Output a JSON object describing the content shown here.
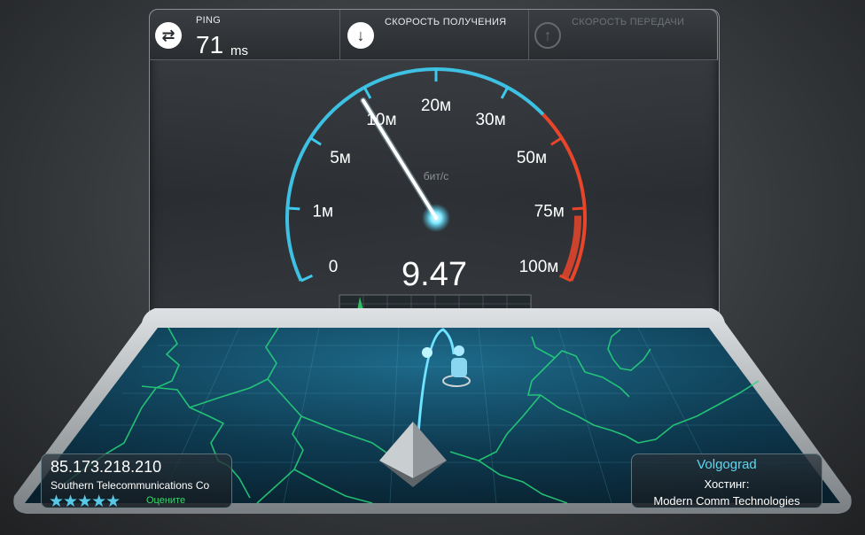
{
  "header": {
    "ping": {
      "label": "PING",
      "value": "71",
      "unit": "ms",
      "icon": "ping-arrows-icon"
    },
    "download": {
      "label": "СКОРОСТЬ ПОЛУЧЕНИЯ",
      "icon": "download-arrow-icon"
    },
    "upload": {
      "label": "СКОРОСТЬ ПЕРЕДАЧИ",
      "icon": "upload-arrow-icon"
    }
  },
  "gauge": {
    "ticks": [
      {
        "label": "0",
        "value": 0
      },
      {
        "label": "1м",
        "value": 1
      },
      {
        "label": "5м",
        "value": 5
      },
      {
        "label": "10м",
        "value": 10
      },
      {
        "label": "20м",
        "value": 20
      },
      {
        "label": "30м",
        "value": 30
      },
      {
        "label": "50м",
        "value": 50
      },
      {
        "label": "75м",
        "value": 75
      },
      {
        "label": "100м",
        "value": 100
      }
    ],
    "unit": "бит/с",
    "reading": "9.47",
    "needle_value": 9.47
  },
  "client": {
    "ip": "85.173.218.210",
    "isp": "Southern Telecommunications Co",
    "stars": "★★★★★",
    "rate_label": "Оцените"
  },
  "server": {
    "city": "Volgograd",
    "hosting_label": "Хостинг:",
    "name": "Modern Comm Technologies"
  },
  "colors": {
    "accent": "#3ec8ec",
    "danger": "#e8452a",
    "map_lines": "#27d77a"
  }
}
